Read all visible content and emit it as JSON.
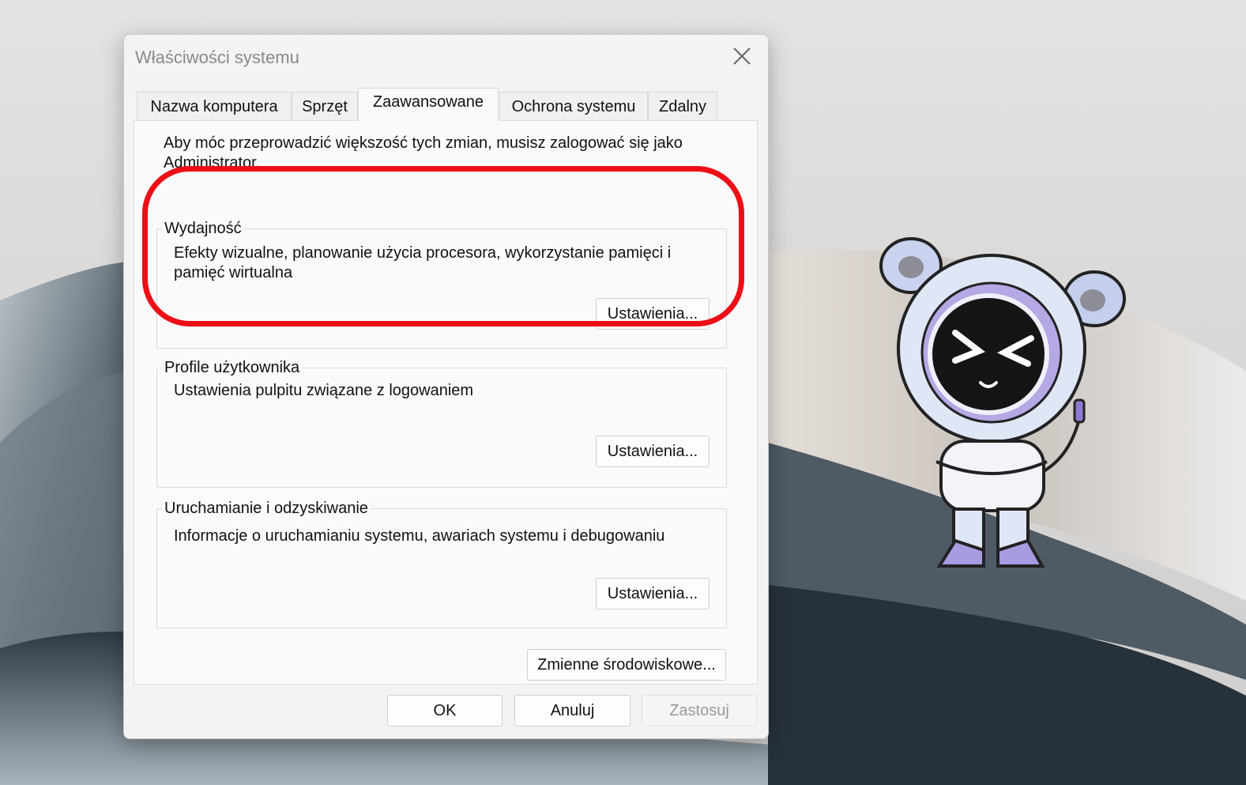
{
  "window": {
    "title": "Właściwości systemu"
  },
  "tabs": [
    {
      "label": "Nazwa komputera",
      "active": false
    },
    {
      "label": "Sprzęt",
      "active": false
    },
    {
      "label": "Zaawansowane",
      "active": true
    },
    {
      "label": "Ochrona systemu",
      "active": false
    },
    {
      "label": "Zdalny",
      "active": false
    }
  ],
  "intro_text": "Aby móc przeprowadzić większość tych zmian, musisz zalogować się jako Administrator.",
  "groups": {
    "performance": {
      "title": "Wydajność",
      "description": "Efekty wizualne, planowanie użycia procesora, wykorzystanie pamięci i pamięć wirtualna",
      "button_label": "Ustawienia..."
    },
    "user_profiles": {
      "title": "Profile użytkownika",
      "description": "Ustawienia pulpitu związane z logowaniem",
      "button_label": "Ustawienia..."
    },
    "startup_recovery": {
      "title": "Uruchamianie i odzyskiwanie",
      "description": "Informacje o uruchamianiu systemu, awariach systemu i debugowaniu",
      "button_label": "Ustawienia..."
    }
  },
  "env_button_label": "Zmienne środowiskowe...",
  "footer": {
    "ok_label": "OK",
    "cancel_label": "Anuluj",
    "apply_label": "Zastosuj",
    "apply_enabled": false
  },
  "icons": {
    "close": "close-icon"
  },
  "colors": {
    "annotation": "#ec0f17",
    "disabled_text": "#9a9a9a"
  }
}
